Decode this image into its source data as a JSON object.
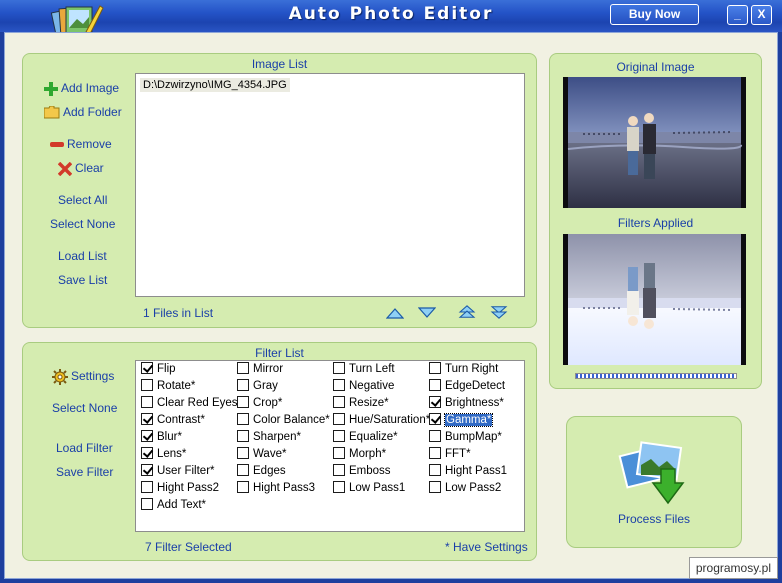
{
  "window": {
    "title": "Auto Photo Editor",
    "buy_label": "Buy Now",
    "minimize_label": "_",
    "close_label": "X"
  },
  "image_list": {
    "title": "Image List",
    "add_image": "Add Image",
    "add_folder": "Add Folder",
    "remove": "Remove",
    "clear": "Clear",
    "select_all": "Select All",
    "select_none": "Select None",
    "load_list": "Load List",
    "save_list": "Save List",
    "files": [
      "D:\\Dzwirzyno\\IMG_4354.JPG"
    ],
    "count_text": "1 Files in List"
  },
  "filter_list": {
    "title": "Filter List",
    "settings": "Settings",
    "select_none": "Select None",
    "load_filter": "Load Filter",
    "save_filter": "Save Filter",
    "selected_text": "7 Filter Selected",
    "note": "* Have Settings",
    "filters": [
      [
        "Flip",
        true
      ],
      [
        "Mirror",
        false
      ],
      [
        "Turn Left",
        false
      ],
      [
        "Turn Right",
        false
      ],
      [
        "Rotate*",
        false
      ],
      [
        "Gray",
        false
      ],
      [
        "Negative",
        false
      ],
      [
        "EdgeDetect",
        false
      ],
      [
        "Clear Red Eyes",
        false
      ],
      [
        "Crop*",
        false
      ],
      [
        "Resize*",
        false
      ],
      [
        "Brightness*",
        true
      ],
      [
        "Contrast*",
        true
      ],
      [
        "Color Balance*",
        false
      ],
      [
        "Hue/Saturation*",
        false
      ],
      [
        "Gamma*",
        true
      ],
      [
        "Blur*",
        true
      ],
      [
        "Sharpen*",
        false
      ],
      [
        "Equalize*",
        false
      ],
      [
        "BumpMap*",
        false
      ],
      [
        "Lens*",
        true
      ],
      [
        "Wave*",
        false
      ],
      [
        "Morph*",
        false
      ],
      [
        "FFT*",
        false
      ],
      [
        "User Filter*",
        true
      ],
      [
        "Edges",
        false
      ],
      [
        "Emboss",
        false
      ],
      [
        "Hight Pass1",
        false
      ],
      [
        "Hight Pass2",
        false
      ],
      [
        "Hight Pass3",
        false
      ],
      [
        "Low Pass1",
        false
      ],
      [
        "Low Pass2",
        false
      ],
      [
        "Add Text*",
        false
      ]
    ]
  },
  "preview": {
    "original_title": "Original Image",
    "filtered_title": "Filters Applied"
  },
  "process": {
    "label": "Process Files"
  },
  "watermark": "programosy.pl",
  "colors": {
    "titlebar": "#2453c7",
    "panel": "#d5ecb0",
    "link": "#1a3fa8",
    "client": "#f1f1e2"
  }
}
